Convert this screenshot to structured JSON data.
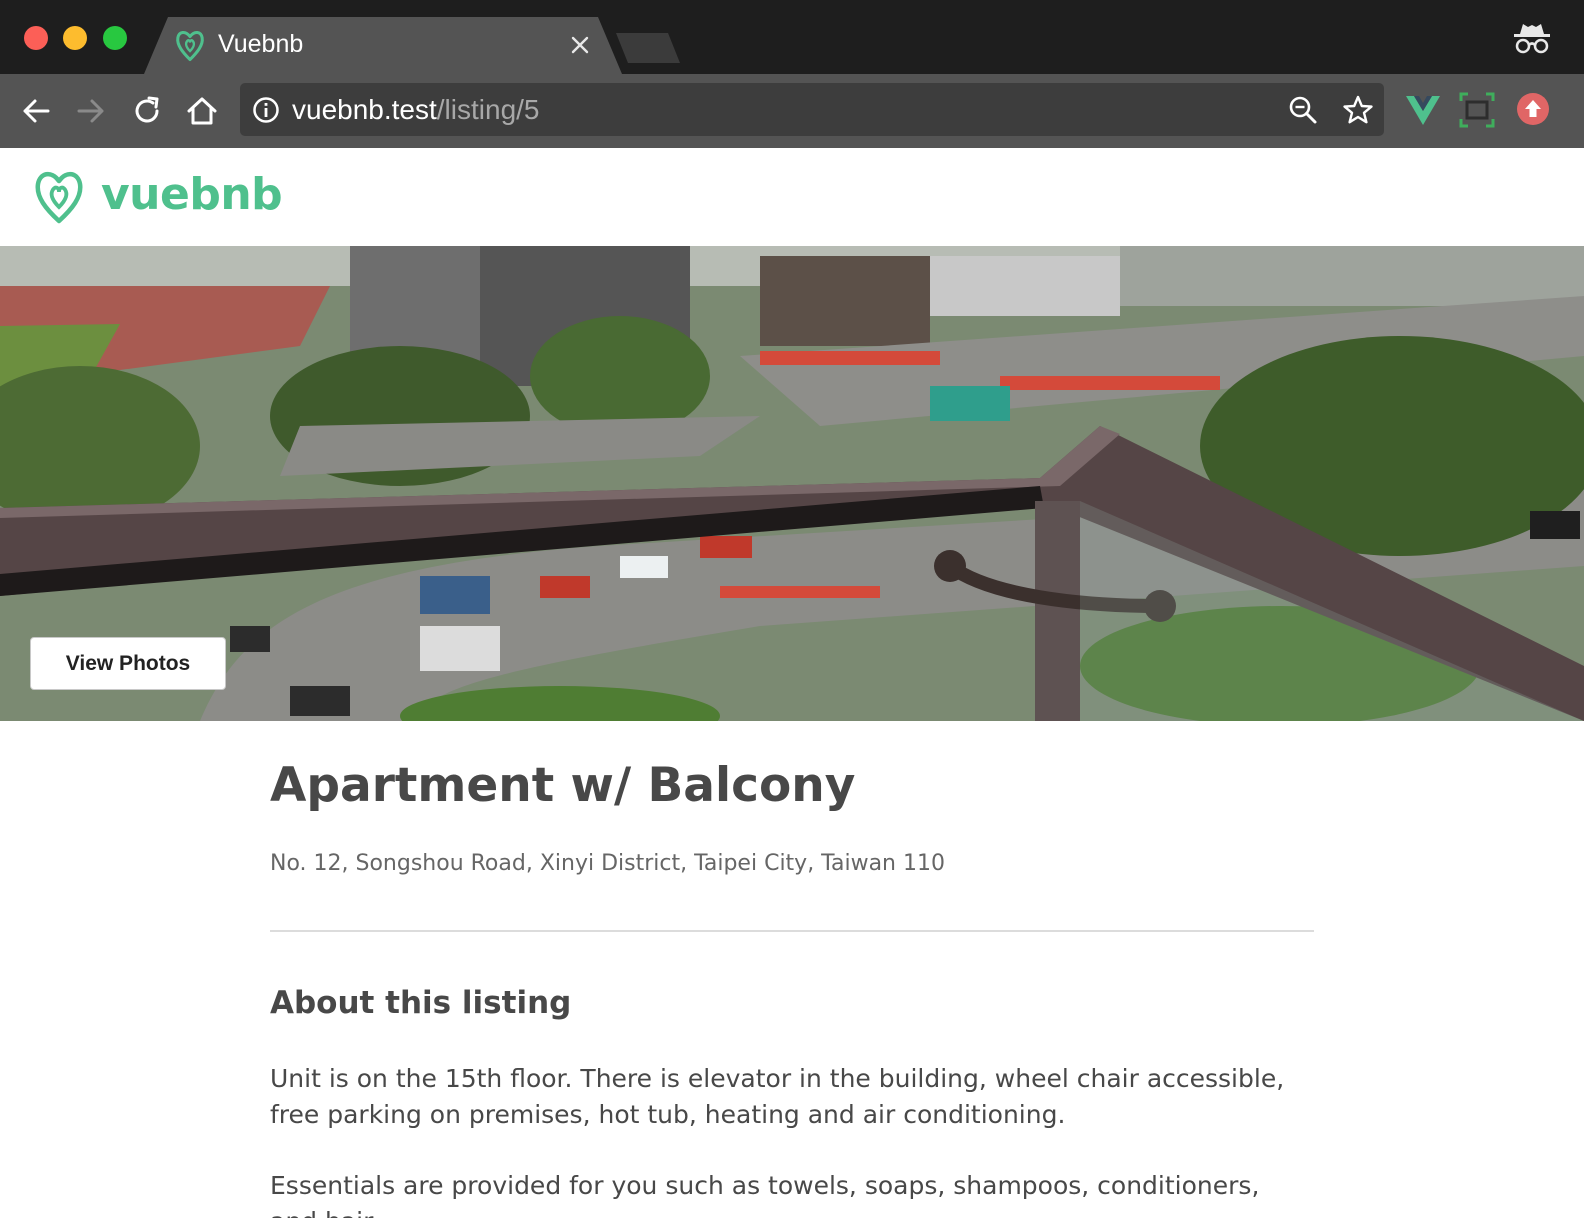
{
  "browser": {
    "tab_title": "Vuebnb",
    "url_host": "vuebnb.test",
    "url_path": "/listing/5",
    "icons": [
      "back-arrow-icon",
      "forward-arrow-icon",
      "reload-icon",
      "home-icon",
      "site-info-icon",
      "zoom-icon",
      "bookmark-star-icon",
      "vue-devtools-icon",
      "screen-capture-icon",
      "update-icon",
      "incognito-icon"
    ]
  },
  "site": {
    "brand": "vuebnb",
    "brand_color": "#4fc08d"
  },
  "hero": {
    "button_label": "View Photos"
  },
  "listing": {
    "title": "Apartment w/ Balcony",
    "address": "No. 12, Songshou Road, Xinyi District, Taipei City, Taiwan 110",
    "about_heading": "About this listing",
    "about_paragraphs": [
      "Unit is on the 15th floor. There is elevator in the building, wheel chair accessible, free parking on premises, hot tub, heating and air conditioning.",
      "Essentials are provided for you such as towels, soaps, shampoos, conditioners, and hair"
    ]
  }
}
